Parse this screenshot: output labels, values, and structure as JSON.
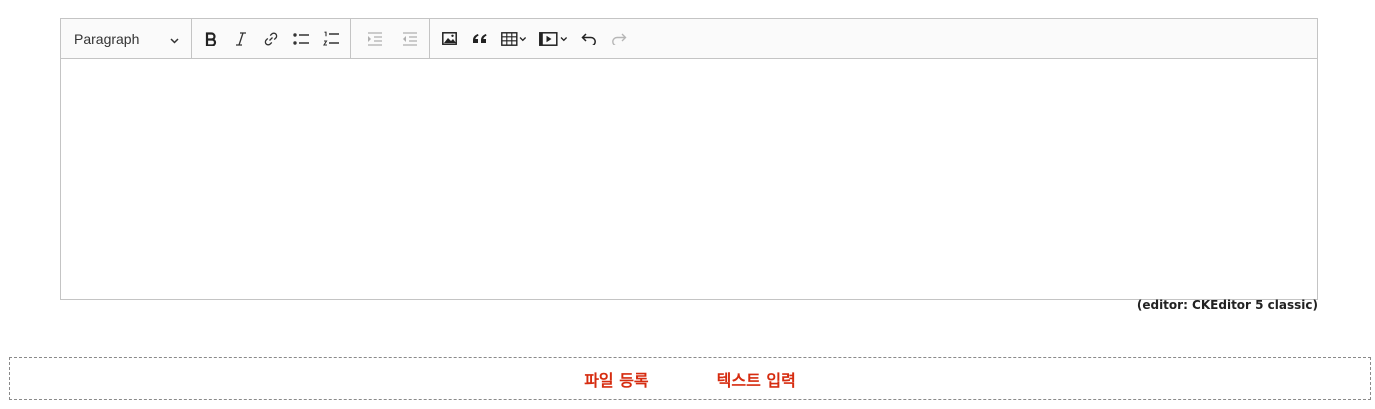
{
  "editor": {
    "heading_dropdown": "Paragraph",
    "toolbar_buttons": [
      "bold-icon",
      "italic-icon",
      "link-icon",
      "bulleted-list-icon",
      "numbered-list-icon",
      "increase-indent-icon",
      "decrease-indent-icon",
      "image-icon",
      "blockquote-icon",
      "table-icon",
      "media-icon",
      "undo-icon",
      "redo-icon"
    ],
    "caption": "(editor: CKEditor 5 classic)"
  },
  "actions": {
    "file_upload": "파일 등록",
    "text_input": "텍스트 입력"
  },
  "colors": {
    "accent": "#d62c10",
    "toolbar_bg": "#fafafa",
    "border": "#c4c4c4"
  }
}
